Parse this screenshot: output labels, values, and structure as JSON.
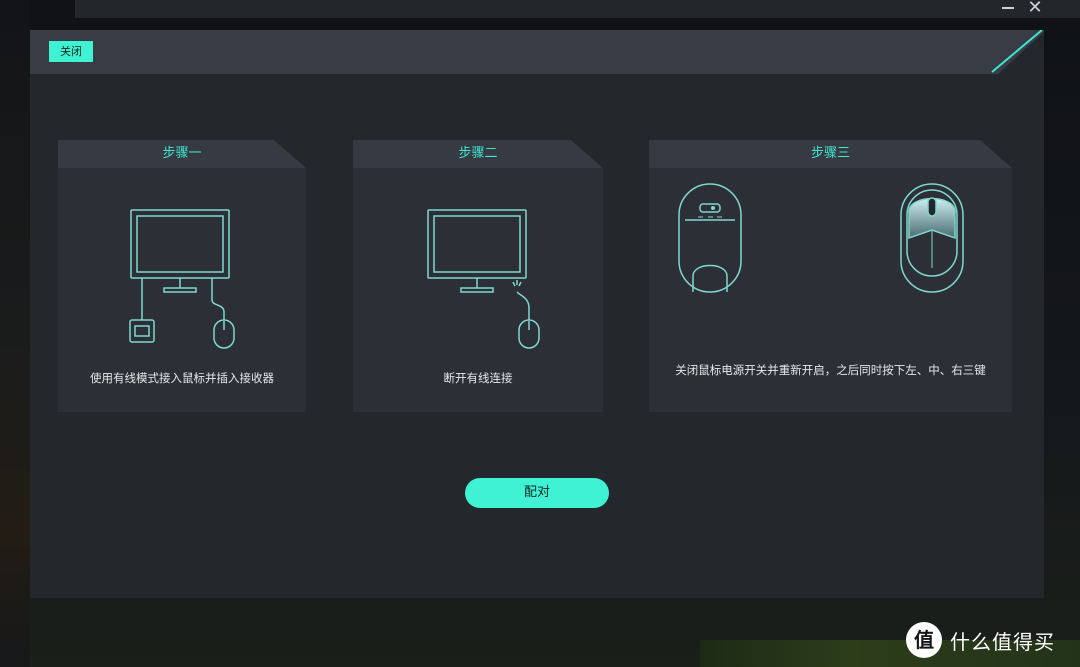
{
  "window": {
    "minimize_icon": "minimize-icon",
    "close_glyph": "✕"
  },
  "dialog": {
    "close_label": "关闭",
    "steps": [
      {
        "title": "步骤一",
        "description": "使用有线模式接入鼠标并插入接收器",
        "illustration": "monitor-with-receiver-and-wired-mouse"
      },
      {
        "title": "步骤二",
        "description": "断开有线连接",
        "illustration": "monitor-with-disconnected-mouse"
      },
      {
        "title": "步骤三",
        "description": "关闭鼠标电源开关并重新开启，之后同时按下左、中、右三键",
        "illustration": "mouse-bottom-and-top-views"
      }
    ],
    "pair_label": "配对"
  },
  "watermark": {
    "logo_glyph": "值",
    "text": "什么值得买"
  },
  "colors": {
    "accent": "#3ff2d3",
    "title_accent": "#3fe6cf",
    "line_art": "#7fd8d0",
    "dialog_bg": "#24272c",
    "card_bg": "#2c2f35"
  }
}
